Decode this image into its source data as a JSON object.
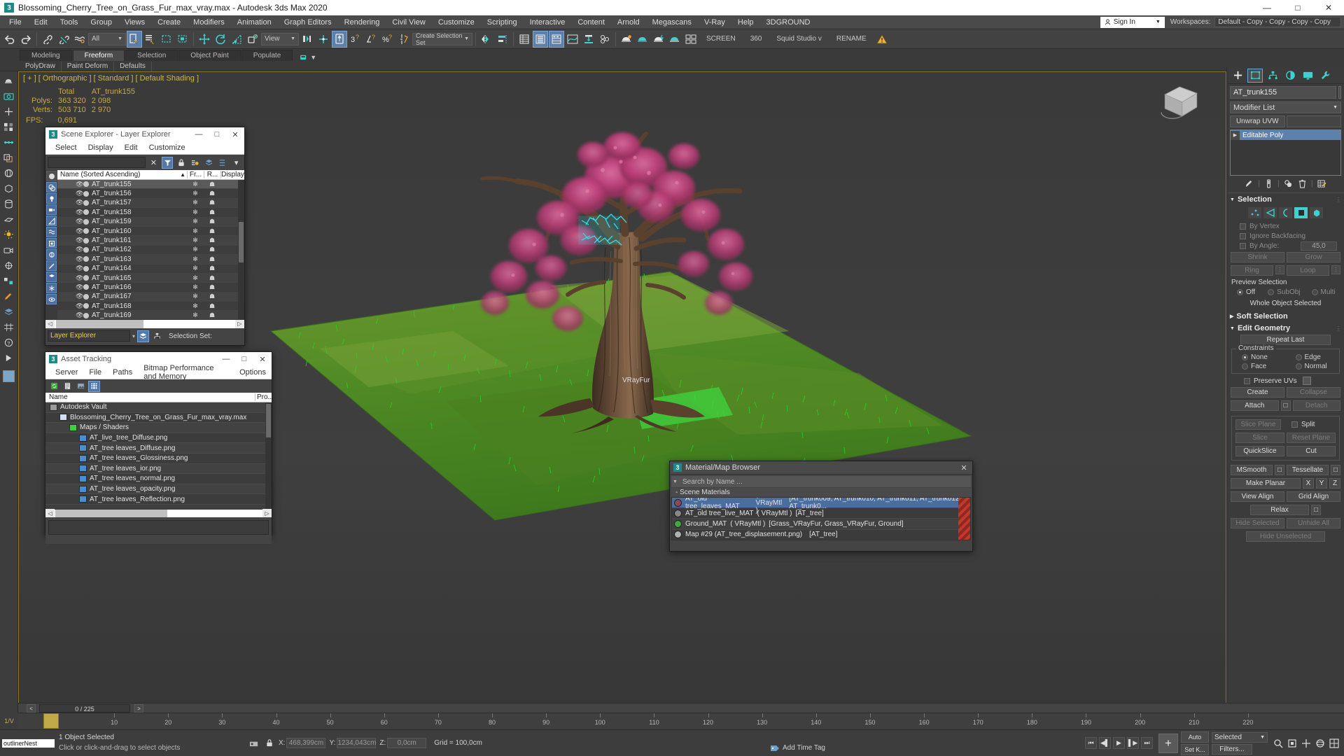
{
  "titlebar": {
    "text": "Blossoming_Cherry_Tree_on_Grass_Fur_max_vray.max - Autodesk 3ds Max 2020",
    "logo": "3",
    "minimize": "—",
    "maximize": "□",
    "close": "✕"
  },
  "menubar": {
    "items": [
      "File",
      "Edit",
      "Tools",
      "Group",
      "Views",
      "Create",
      "Modifiers",
      "Animation",
      "Graph Editors",
      "Rendering",
      "Civil View",
      "Customize",
      "Scripting",
      "Interactive",
      "Content",
      "Arnold",
      "Megascans",
      "V-Ray",
      "Help",
      "3DGROUND"
    ],
    "signin": "Sign In",
    "workspaces_label": "Workspaces:",
    "workspaces_value": "Default - Copy - Copy - Copy - Copy"
  },
  "toolbar": {
    "selection_filter": "All",
    "reference_coord": "View",
    "selection_set": "Create Selection Set",
    "screen_label": "SCREEN",
    "deg_label": "360",
    "squid_label": "Squid Studio v",
    "rename_label": "RENAME"
  },
  "ribbon": {
    "tabs": [
      "Modeling",
      "Freeform",
      "Selection",
      "Object Paint",
      "Populate"
    ],
    "active_tab": "Freeform",
    "subtabs": [
      "PolyDraw",
      "Paint Deform",
      "Defaults"
    ]
  },
  "viewport": {
    "label": "[ + ] [ Orthographic ] [ Standard ] [ Default Shading ]",
    "stats": {
      "col_total": "Total",
      "col_object": "AT_trunk155",
      "polys_label": "Polys:",
      "polys_total": "363 320",
      "polys_object": "2 098",
      "verts_label": "Verts:",
      "verts_total": "503 710",
      "verts_object": "2 970"
    },
    "fps_label": "FPS:",
    "fps_value": "0,691",
    "object_tag": "VRayFur"
  },
  "scene_explorer": {
    "title": "Scene Explorer - Layer Explorer",
    "logo": "3",
    "menu": [
      "Select",
      "Display",
      "Edit",
      "Customize"
    ],
    "search_value": "",
    "columns": {
      "name": "Name (Sorted Ascending)",
      "sort_arrow": "▲",
      "frozen": "Fr...",
      "render": "R...",
      "display": "Display"
    },
    "rows": [
      {
        "name": "AT_trunk155",
        "selected": true
      },
      {
        "name": "AT_trunk156",
        "selected": false
      },
      {
        "name": "AT_trunk157",
        "selected": false
      },
      {
        "name": "AT_trunk158",
        "selected": false
      },
      {
        "name": "AT_trunk159",
        "selected": false
      },
      {
        "name": "AT_trunk160",
        "selected": false
      },
      {
        "name": "AT_trunk161",
        "selected": false
      },
      {
        "name": "AT_trunk162",
        "selected": false
      },
      {
        "name": "AT_trunk163",
        "selected": false
      },
      {
        "name": "AT_trunk164",
        "selected": false
      },
      {
        "name": "AT_trunk165",
        "selected": false
      },
      {
        "name": "AT_trunk166",
        "selected": false
      },
      {
        "name": "AT_trunk167",
        "selected": false
      },
      {
        "name": "AT_trunk168",
        "selected": false
      },
      {
        "name": "AT_trunk169",
        "selected": false
      }
    ],
    "footer_dropdown": "Layer Explorer",
    "selection_set_label": "Selection Set:"
  },
  "asset_tracking": {
    "title": "Asset Tracking",
    "logo": "3",
    "menu": [
      "Server",
      "File",
      "Paths",
      "Bitmap Performance and Memory",
      "Options"
    ],
    "columns": {
      "name": "Name",
      "status": "Pro..."
    },
    "rows": [
      {
        "label": "Autodesk Vault",
        "icon": "vault-icon",
        "indent": 0
      },
      {
        "label": "Blossoming_Cherry_Tree_on_Grass_Fur_max_vray.max",
        "icon": "max-file-icon",
        "indent": 1
      },
      {
        "label": "Maps / Shaders",
        "icon": "maps-folder-icon",
        "indent": 2
      },
      {
        "label": "AT_live_tree_Diffuse.png",
        "icon": "png-icon",
        "indent": 3
      },
      {
        "label": "AT_tree leaves_Diffuse.png",
        "icon": "png-icon",
        "indent": 3
      },
      {
        "label": "AT_tree leaves_Glossiness.png",
        "icon": "png-icon",
        "indent": 3
      },
      {
        "label": "AT_tree leaves_ior.png",
        "icon": "png-icon",
        "indent": 3
      },
      {
        "label": "AT_tree leaves_normal.png",
        "icon": "png-icon",
        "indent": 3
      },
      {
        "label": "AT_tree leaves_opacity.png",
        "icon": "png-icon",
        "indent": 3
      },
      {
        "label": "AT_tree leaves_Reflection.png",
        "icon": "png-icon",
        "indent": 3
      }
    ]
  },
  "material_browser": {
    "title": "Material/Map Browser",
    "logo": "3",
    "close": "✕",
    "search_placeholder": "Search by Name ...",
    "group_label": "- Scene Materials",
    "rows": [
      {
        "name": "AT_old tree_leaves_MAT",
        "type": "( VRayMtl )",
        "assigned": "[AT_trunk009, AT_trunk010, AT_trunk011, AT_trunk012, AT_trunk0...",
        "swatch": "#8a4a55",
        "selected": true
      },
      {
        "name": "AT_old tree_live_MAT",
        "type": "( VRayMtl )",
        "assigned": "[AT_tree]",
        "swatch": "#888888",
        "selected": false
      },
      {
        "name": "Ground_MAT",
        "type": "( VRayMtl )",
        "assigned": "[Grass_VRayFur, Grass_VRayFur, Ground]",
        "swatch": "#3fa83f",
        "selected": false
      },
      {
        "name": "Map #29 (AT_tree_displasement.png)",
        "type": "",
        "assigned": "[AT_tree]",
        "swatch": "#b0b0b0",
        "selected": false
      }
    ]
  },
  "command_panel": {
    "tabs": [
      "create-tab",
      "modify-tab",
      "hierarchy-tab",
      "motion-tab",
      "display-tab",
      "utilities-tab"
    ],
    "active_tab": "modify-tab",
    "object_name": "AT_trunk155",
    "modifier_list": "Modifier List",
    "unwrap_button": "Unwrap UVW",
    "stack": [
      "Editable Poly"
    ],
    "selection": {
      "title": "Selection",
      "by_vertex": "By Vertex",
      "ignore_backfacing": "Ignore Backfacing",
      "by_angle": "By Angle:",
      "by_angle_value": "45,0",
      "shrink": "Shrink",
      "grow": "Grow",
      "ring": "Ring",
      "loop": "Loop",
      "preview_selection": "Preview Selection",
      "off": "Off",
      "subobj": "SubObj",
      "multi": "Multi",
      "status": "Whole Object Selected"
    },
    "soft_selection": {
      "title": "Soft Selection"
    },
    "edit_geometry": {
      "title": "Edit Geometry",
      "repeat_last": "Repeat Last",
      "constraints_label": "Constraints",
      "constraint_none": "None",
      "constraint_edge": "Edge",
      "constraint_face": "Face",
      "constraint_normal": "Normal",
      "preserve_uvs": "Preserve UVs",
      "create": "Create",
      "collapse": "Collapse",
      "attach": "Attach",
      "detach": "Detach",
      "slice_plane": "Slice Plane",
      "split": "Split",
      "slice": "Slice",
      "reset_plane": "Reset Plane",
      "quickslice": "QuickSlice",
      "cut": "Cut",
      "msmooth": "MSmooth",
      "tessellate": "Tessellate",
      "make_planar": "Make Planar",
      "axis_x": "X",
      "axis_y": "Y",
      "axis_z": "Z",
      "view_align": "View Align",
      "grid_align": "Grid Align",
      "relax": "Relax",
      "hide_selected": "Hide Selected",
      "unhide_all": "Unhide All",
      "hide_unselected": "Hide Unselected"
    }
  },
  "timeline": {
    "frame_display": "0 / 225",
    "prev_arrow": "<",
    "next_arrow": ">",
    "ticks": [
      "10",
      "20",
      "30",
      "40",
      "50",
      "60",
      "70",
      "80",
      "90",
      "100",
      "110",
      "120",
      "130",
      "140",
      "150",
      "160",
      "170",
      "180",
      "190",
      "200",
      "210",
      "220"
    ],
    "tag": "1/V"
  },
  "statusbar": {
    "app_label": "outlinerNest",
    "message_1": "1 Object Selected",
    "message_2": "Click or click-and-drag to select objects",
    "x_label": "X:",
    "x_value": "468,399cm",
    "y_label": "Y:",
    "y_value": "1234,043cm",
    "z_label": "Z:",
    "z_value": "0,0cm",
    "grid_label": "Grid = 100,0cm",
    "add_time_tag": "Add Time Tag",
    "auto_key": "Auto",
    "set_key": "Set K...",
    "selected_dropdown": "Selected",
    "filters": "Filters..."
  }
}
